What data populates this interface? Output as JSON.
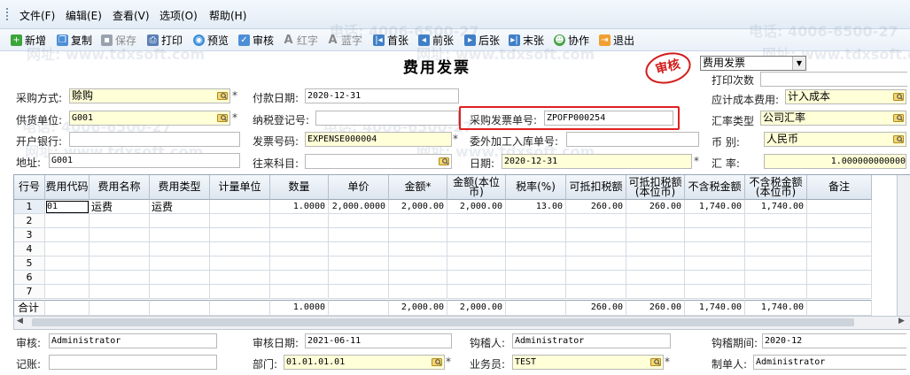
{
  "menu": [
    "文件(F)",
    "编辑(E)",
    "查看(V)",
    "选项(O)",
    "帮助(H)"
  ],
  "toolbar": [
    {
      "label": "新增",
      "icon": "plus-icon",
      "disabled": false
    },
    {
      "label": "复制",
      "icon": "copy-icon",
      "disabled": false
    },
    {
      "label": "保存",
      "icon": "save-icon",
      "disabled": true
    },
    {
      "label": "打印",
      "icon": "print-icon",
      "disabled": false
    },
    {
      "label": "预览",
      "icon": "preview-icon",
      "disabled": false
    },
    {
      "label": "审核",
      "icon": "approve-icon",
      "disabled": false
    },
    {
      "label": "红字",
      "icon": "red-text-icon",
      "disabled": true
    },
    {
      "label": "蓝字",
      "icon": "blue-text-icon",
      "disabled": true
    },
    {
      "label": "首张",
      "icon": "first-icon",
      "disabled": false
    },
    {
      "label": "前张",
      "icon": "prev-icon",
      "disabled": false
    },
    {
      "label": "后张",
      "icon": "next-icon",
      "disabled": false
    },
    {
      "label": "末张",
      "icon": "last-icon",
      "disabled": false
    },
    {
      "label": "协作",
      "icon": "collaborate-icon",
      "disabled": false
    },
    {
      "label": "退出",
      "icon": "exit-icon",
      "disabled": false
    }
  ],
  "form": {
    "title": "费用发票",
    "stamp": "审核",
    "doc_type": "费用发票",
    "print_count_label": "打印次数",
    "purchase_method_label": "采购方式:",
    "purchase_method": "赊购",
    "supplier_label": "供货单位:",
    "supplier": "G001",
    "bank_label": "开户银行:",
    "bank": "",
    "address_label": "地址:",
    "address": "G001",
    "pay_date_label": "付款日期:",
    "pay_date": "2020-12-31",
    "tax_reg_label": "纳税登记号:",
    "tax_reg": "",
    "invoice_no_label": "发票号码:",
    "invoice_no": "EXPENSE000004",
    "account_label": "往来科目:",
    "account": "",
    "purchase_invoice_label": "采购发票单号:",
    "purchase_invoice": "ZPOFP000254",
    "outsourced_label": "委外加工入库单号:",
    "outsourced": "",
    "date_label": "日期:",
    "date": "2020-12-31",
    "cost_label": "应计成本费用:",
    "cost": "计入成本",
    "rate_type_label": "汇率类型",
    "rate_type": "公司汇率",
    "currency_label": "币    别:",
    "currency": "人民币",
    "rate_label": "汇    率:",
    "rate": "1.000000000000"
  },
  "grid": {
    "headers": [
      "行号",
      "费用代码",
      "费用名称",
      "费用类型",
      "计量单位",
      "数量",
      "单价",
      "金额*",
      "金额(本位币)",
      "税率(%)",
      "可抵扣税额",
      "可抵扣税额(本位币)",
      "不含税金额",
      "不含税金额(本位币)",
      "备注"
    ],
    "rows": [
      [
        "1",
        "01",
        "运费",
        "运费",
        "",
        "1.0000",
        "2,000.0000",
        "2,000.00",
        "2,000.00",
        "13.00",
        "260.00",
        "260.00",
        "1,740.00",
        "1,740.00",
        ""
      ],
      [
        "2",
        "",
        "",
        "",
        "",
        "",
        "",
        "",
        "",
        "",
        "",
        "",
        "",
        "",
        ""
      ],
      [
        "3",
        "",
        "",
        "",
        "",
        "",
        "",
        "",
        "",
        "",
        "",
        "",
        "",
        "",
        ""
      ],
      [
        "4",
        "",
        "",
        "",
        "",
        "",
        "",
        "",
        "",
        "",
        "",
        "",
        "",
        "",
        ""
      ],
      [
        "5",
        "",
        "",
        "",
        "",
        "",
        "",
        "",
        "",
        "",
        "",
        "",
        "",
        "",
        ""
      ],
      [
        "6",
        "",
        "",
        "",
        "",
        "",
        "",
        "",
        "",
        "",
        "",
        "",
        "",
        "",
        ""
      ],
      [
        "7",
        "",
        "",
        "",
        "",
        "",
        "",
        "",
        "",
        "",
        "",
        "",
        "",
        "",
        ""
      ]
    ],
    "total_row": [
      "合计",
      "",
      "",
      "",
      "",
      "1.0000",
      "",
      "2,000.00",
      "2,000.00",
      "",
      "260.00",
      "260.00",
      "1,740.00",
      "1,740.00",
      ""
    ]
  },
  "footer": {
    "auditor_label": "审核:",
    "auditor": "Administrator",
    "audit_date_label": "审核日期:",
    "audit_date": "2021-06-11",
    "checker_label": "钩稽人:",
    "checker": "Administrator",
    "check_period_label": "钩稽期间:",
    "check_period": "2020-12",
    "bookkeeper_label": "记账:",
    "bookkeeper": "",
    "dept_label": "部门:",
    "dept": "01.01.01.01",
    "salesman_label": "业务员:",
    "salesman": "TEST",
    "maker_label": "制单人:",
    "maker": "Administrator"
  },
  "watermark": [
    "电话: 4006-6500-27",
    "网址: www.tdxsoft.com"
  ],
  "colors": {
    "required_field": "#ffffd8",
    "highlight_box": "#e02020",
    "stamp": "#d31c1c"
  }
}
